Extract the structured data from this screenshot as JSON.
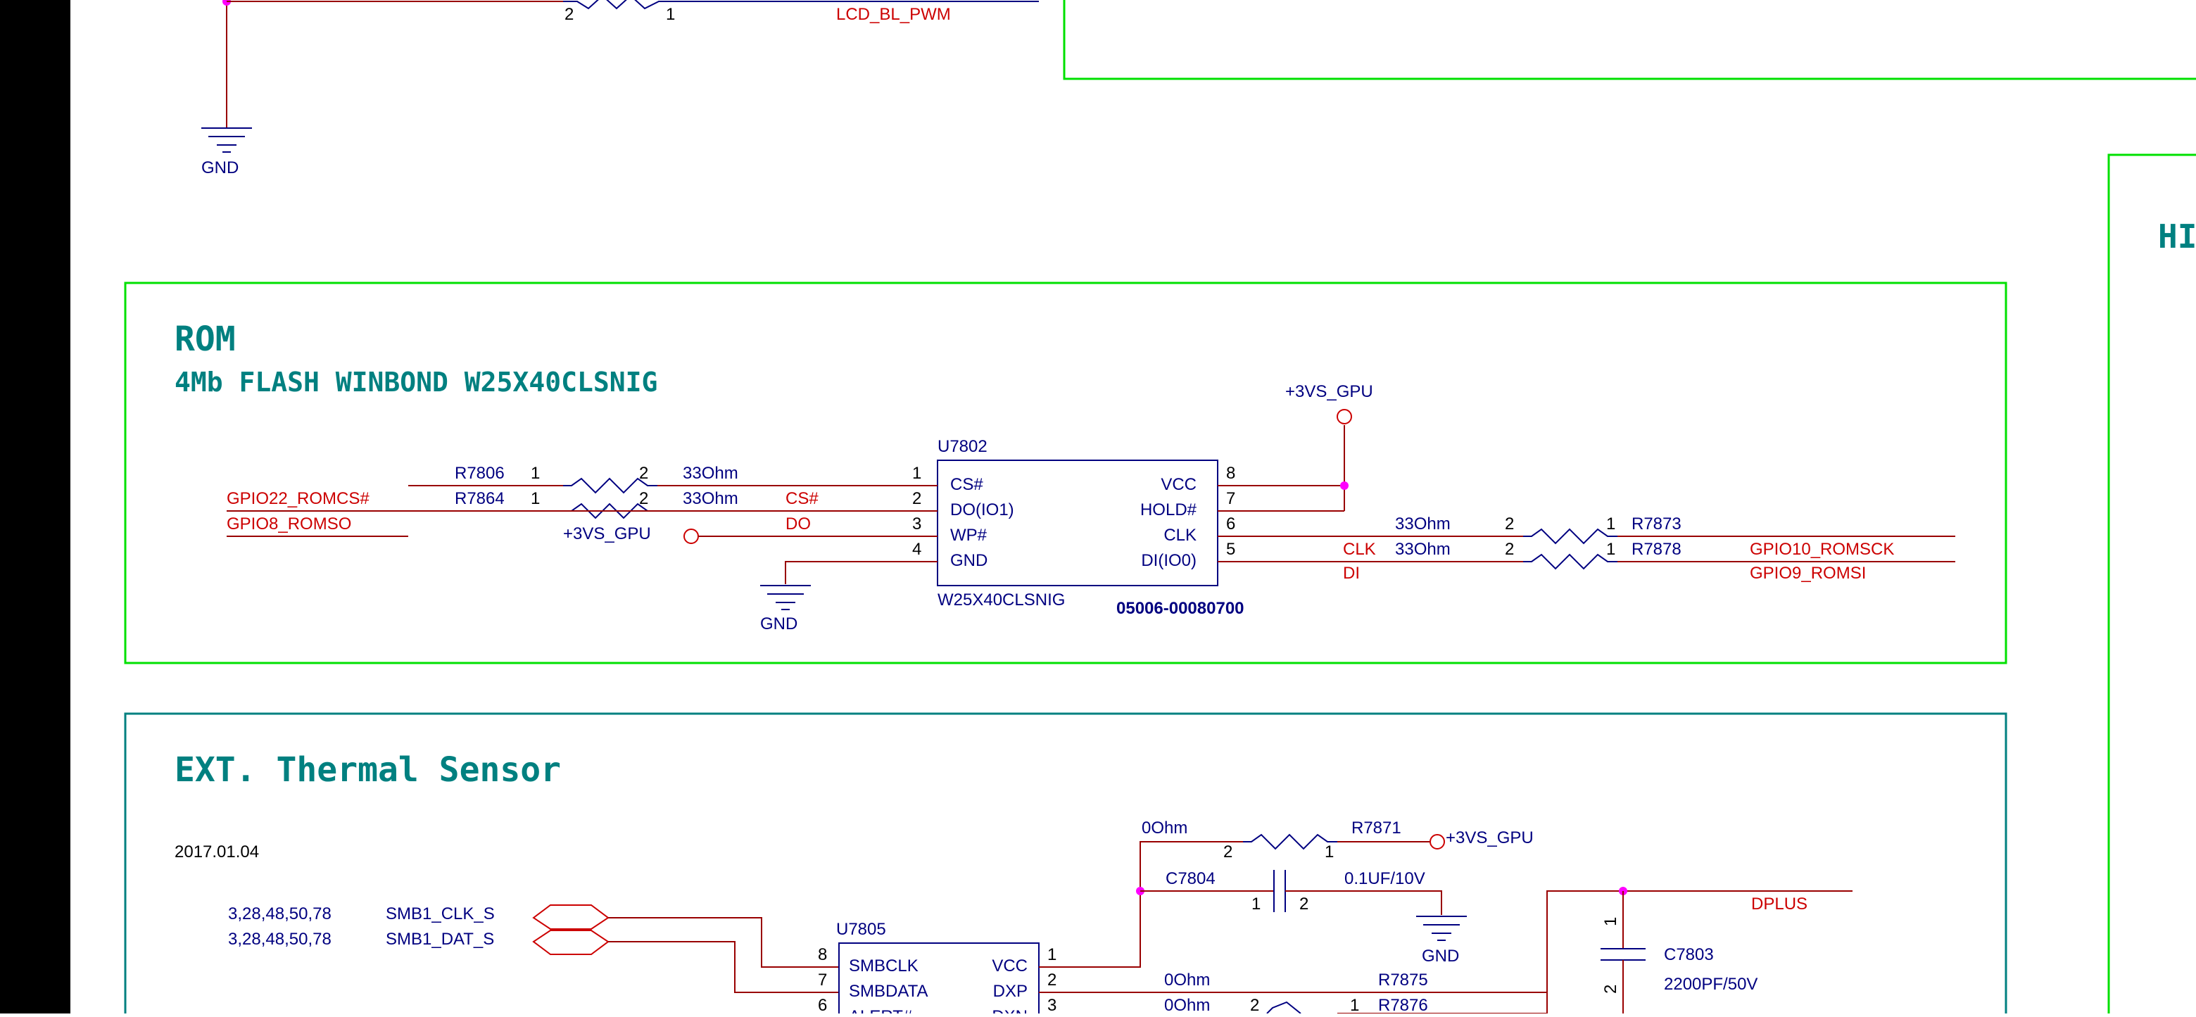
{
  "colors": {
    "frame": "#00e000",
    "frame_teal": "#008080",
    "wire": "#990000",
    "net": "#cc0000",
    "part": "#000080",
    "junction": "#ff00ff"
  },
  "top": {
    "net_lcd": "LCD_BL_PWM",
    "pin2": "2",
    "pin1": "1",
    "gnd": "GND"
  },
  "right_panel": {
    "title": "HI"
  },
  "rom": {
    "title": "ROM",
    "subtitle": "4Mb FLASH WINBOND W25X40CLSNIG",
    "power": "+3VS_GPU",
    "power2": "+3VS_GPU",
    "gnd": "GND",
    "ic": {
      "ref": "U7802",
      "part": "W25X40CLSNIG",
      "pn": "05006-00080700",
      "left_pins": [
        {
          "n": "1",
          "name": "CS#"
        },
        {
          "n": "2",
          "name": "DO(IO1)"
        },
        {
          "n": "3",
          "name": "WP#"
        },
        {
          "n": "4",
          "name": "GND"
        }
      ],
      "right_pins": [
        {
          "n": "8",
          "name": "VCC"
        },
        {
          "n": "7",
          "name": "HOLD#"
        },
        {
          "n": "6",
          "name": "CLK"
        },
        {
          "n": "5",
          "name": "DI(IO0)"
        }
      ]
    },
    "r7806": {
      "ref": "R7806",
      "p1": "1",
      "p2": "2",
      "val": "33Ohm"
    },
    "r7864": {
      "ref": "R7864",
      "p1": "1",
      "p2": "2",
      "val": "33Ohm"
    },
    "r7873": {
      "ref": "R7873",
      "p1": "1",
      "p2": "2",
      "val": "33Ohm"
    },
    "r7878": {
      "ref": "R7878",
      "p1": "1",
      "p2": "2",
      "val": "33Ohm"
    },
    "nets": {
      "gpio22": "GPIO22_ROMCS#",
      "gpio8": "GPIO8_ROMSO",
      "cs": "CS#",
      "do": "DO",
      "clk": "CLK",
      "di": "DI",
      "gpio10": "GPIO10_ROMSCK",
      "gpio9": "GPIO9_ROMSI"
    }
  },
  "thermal": {
    "title": "EXT. Thermal Sensor",
    "date": "2017.01.04",
    "pages1": "3,28,48,50,78",
    "pages2": "3,28,48,50,78",
    "smb_clk": "SMB1_CLK_S",
    "smb_dat": "SMB1_DAT_S",
    "ic": {
      "ref": "U7805",
      "left_pins": [
        {
          "n": "8",
          "name": "SMBCLK"
        },
        {
          "n": "7",
          "name": "SMBDATA"
        },
        {
          "n": "6",
          "name": "ALERT#"
        }
      ],
      "right_pins": [
        {
          "n": "1",
          "name": "VCC"
        },
        {
          "n": "2",
          "name": "DXP"
        },
        {
          "n": "3",
          "name": "DXN"
        }
      ]
    },
    "r7871": {
      "ref": "R7871",
      "val": "0Ohm",
      "p1": "1",
      "p2": "2"
    },
    "c7804": {
      "ref": "C7804",
      "val": "0.1UF/10V",
      "p1": "1",
      "p2": "2"
    },
    "r7875": {
      "ref": "R7875",
      "val": "0Ohm"
    },
    "r7876": {
      "ref": "R7876",
      "val": "0Ohm",
      "p1": "1",
      "p2": "2"
    },
    "c7803": {
      "ref": "C7803",
      "val": "2200PF/50V",
      "p1": "1",
      "p2": "2"
    },
    "power": "+3VS_GPU",
    "gnd": "GND",
    "dplus": "DPLUS"
  }
}
